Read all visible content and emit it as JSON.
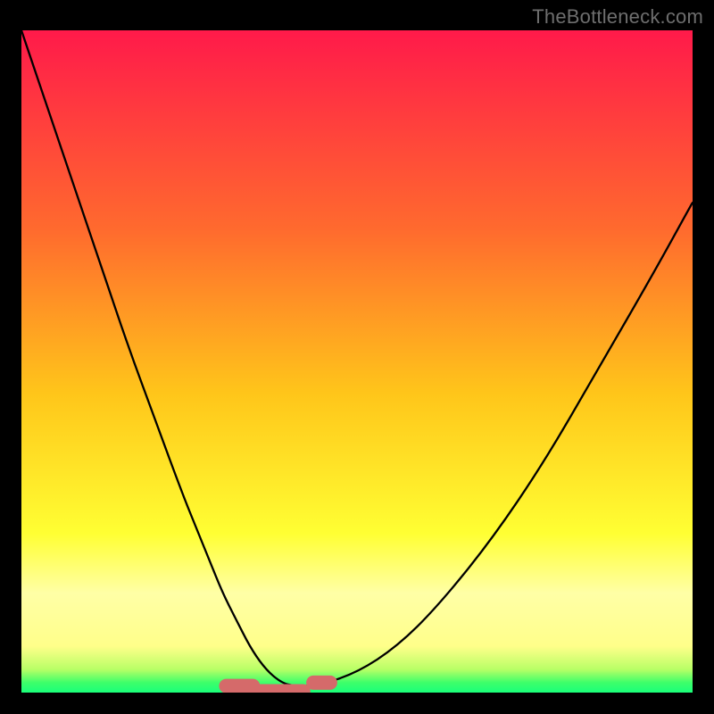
{
  "watermark": "TheBottleneck.com",
  "colors": {
    "page_bg": "#000000",
    "gradient_top": "#ff1a4a",
    "gradient_mid_upper": "#ff7a26",
    "gradient_mid": "#ffd31a",
    "gradient_mid_lower": "#ffff40",
    "gradient_band": "#ffffa6",
    "gradient_green": "#3dff6a",
    "curve": "#000000",
    "marker": "#d56a6a"
  },
  "chart_data": {
    "type": "line",
    "title": "",
    "xlabel": "",
    "ylabel": "",
    "xlim": [
      0,
      100
    ],
    "ylim": [
      0,
      100
    ],
    "series": [
      {
        "name": "bottleneck-curve",
        "x": [
          0,
          4,
          8,
          12,
          16,
          20,
          24,
          26,
          28,
          30,
          32,
          34,
          36,
          38,
          40,
          44,
          50,
          56,
          62,
          70,
          78,
          86,
          94,
          100
        ],
        "y": [
          100,
          88,
          76,
          64,
          52,
          41,
          30,
          25,
          20,
          15,
          11,
          7,
          4,
          2,
          1,
          1,
          3,
          7,
          13,
          23,
          35,
          49,
          63,
          74
        ]
      }
    ],
    "markers": [
      {
        "name": "trough-segment-1",
        "x_range": [
          30.5,
          34.5
        ],
        "y_level": 1.0
      },
      {
        "name": "trough-segment-2",
        "x_range": [
          35.0,
          42.0
        ],
        "y_level": 0.2
      },
      {
        "name": "trough-segment-3",
        "x_range": [
          43.5,
          46.0
        ],
        "y_level": 1.5
      }
    ],
    "gradient_stops": [
      {
        "offset": 0.0,
        "color": "#ff1a4a"
      },
      {
        "offset": 0.3,
        "color": "#ff6a2e"
      },
      {
        "offset": 0.55,
        "color": "#ffc61a"
      },
      {
        "offset": 0.76,
        "color": "#ffff33"
      },
      {
        "offset": 0.85,
        "color": "#ffffa6"
      },
      {
        "offset": 0.93,
        "color": "#ffff8a"
      },
      {
        "offset": 0.965,
        "color": "#b8ff66"
      },
      {
        "offset": 0.985,
        "color": "#3dff6a"
      },
      {
        "offset": 1.0,
        "color": "#1aff7a"
      }
    ]
  }
}
